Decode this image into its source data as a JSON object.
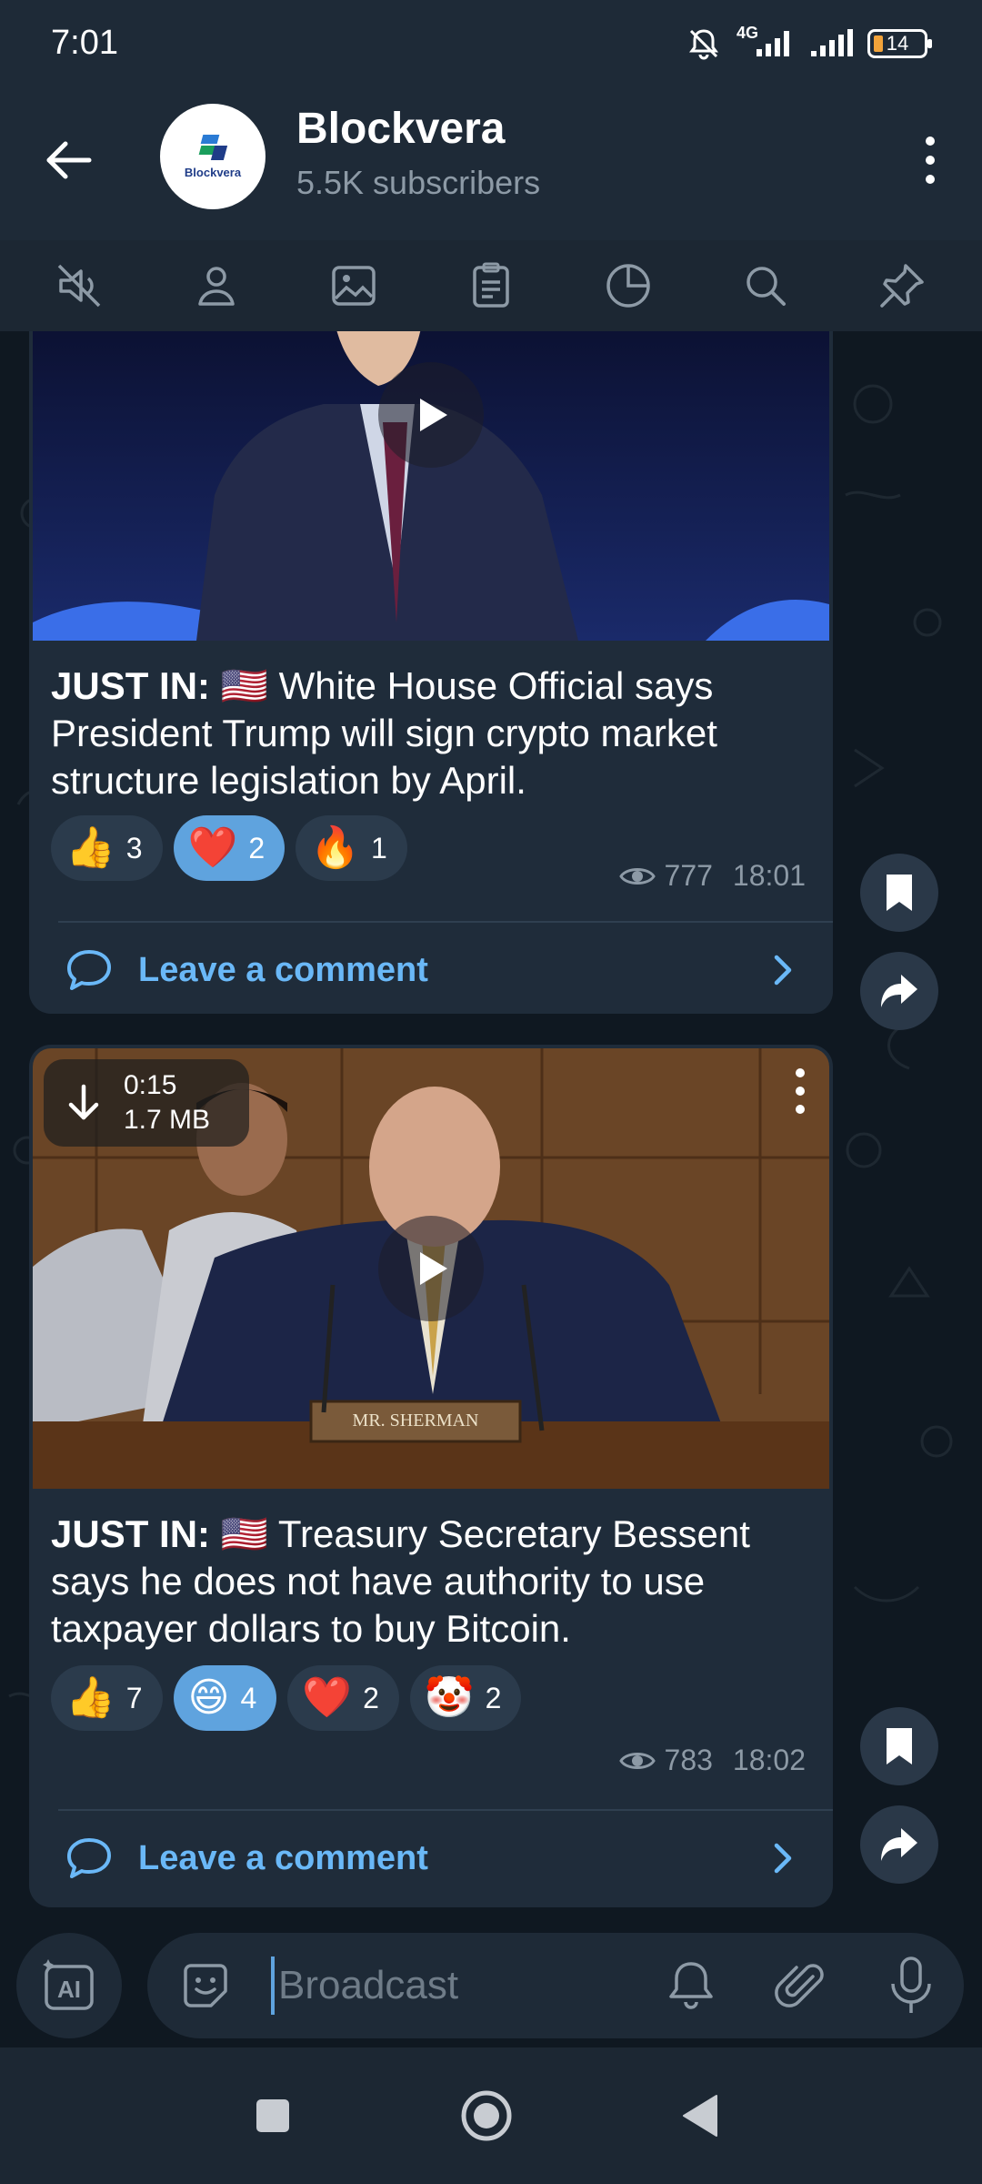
{
  "status_bar": {
    "time": "7:01",
    "network": "4G",
    "battery": "14"
  },
  "header": {
    "title": "Blockvera",
    "subscribers": "5.5K subscribers",
    "avatar_text": "Blockvera"
  },
  "toolbar": {
    "tools": [
      "mute-icon",
      "profile-icon",
      "media-icon",
      "files-icon",
      "stats-icon",
      "search-icon",
      "pin-icon"
    ]
  },
  "messages": [
    {
      "lead": "JUST IN:",
      "flag": "🇺🇸",
      "text": " White House Official says President Trump will sign crypto market structure legislation by April.",
      "reactions": [
        {
          "emoji": "👍",
          "count": "3",
          "active": false
        },
        {
          "emoji": "❤️",
          "count": "2",
          "active": true
        },
        {
          "emoji": "🔥",
          "count": "1",
          "active": false
        }
      ],
      "views": "777",
      "time": "18:01",
      "comment_label": "Leave a comment"
    },
    {
      "lead": "JUST IN:",
      "flag": "🇺🇸",
      "text": " Treasury Secretary Bessent says he does not have authority to use taxpayer dollars to buy Bitcoin.",
      "video_duration": "0:15",
      "video_size": "1.7 MB",
      "nameplate": "MR. SHERMAN",
      "reactions": [
        {
          "emoji": "👍",
          "count": "7",
          "active": false
        },
        {
          "emoji": "😄",
          "count": "4",
          "active": true
        },
        {
          "emoji": "❤️",
          "count": "2",
          "active": false
        },
        {
          "emoji": "🤡",
          "count": "2",
          "active": false
        }
      ],
      "views": "783",
      "time": "18:02",
      "comment_label": "Leave a comment"
    }
  ],
  "composer": {
    "placeholder": "Broadcast",
    "ai_label": "AI"
  },
  "colors": {
    "accent": "#5fa3de",
    "link": "#6ab8f7",
    "bubble": "#1f2c3a",
    "header": "#1e2a37"
  }
}
